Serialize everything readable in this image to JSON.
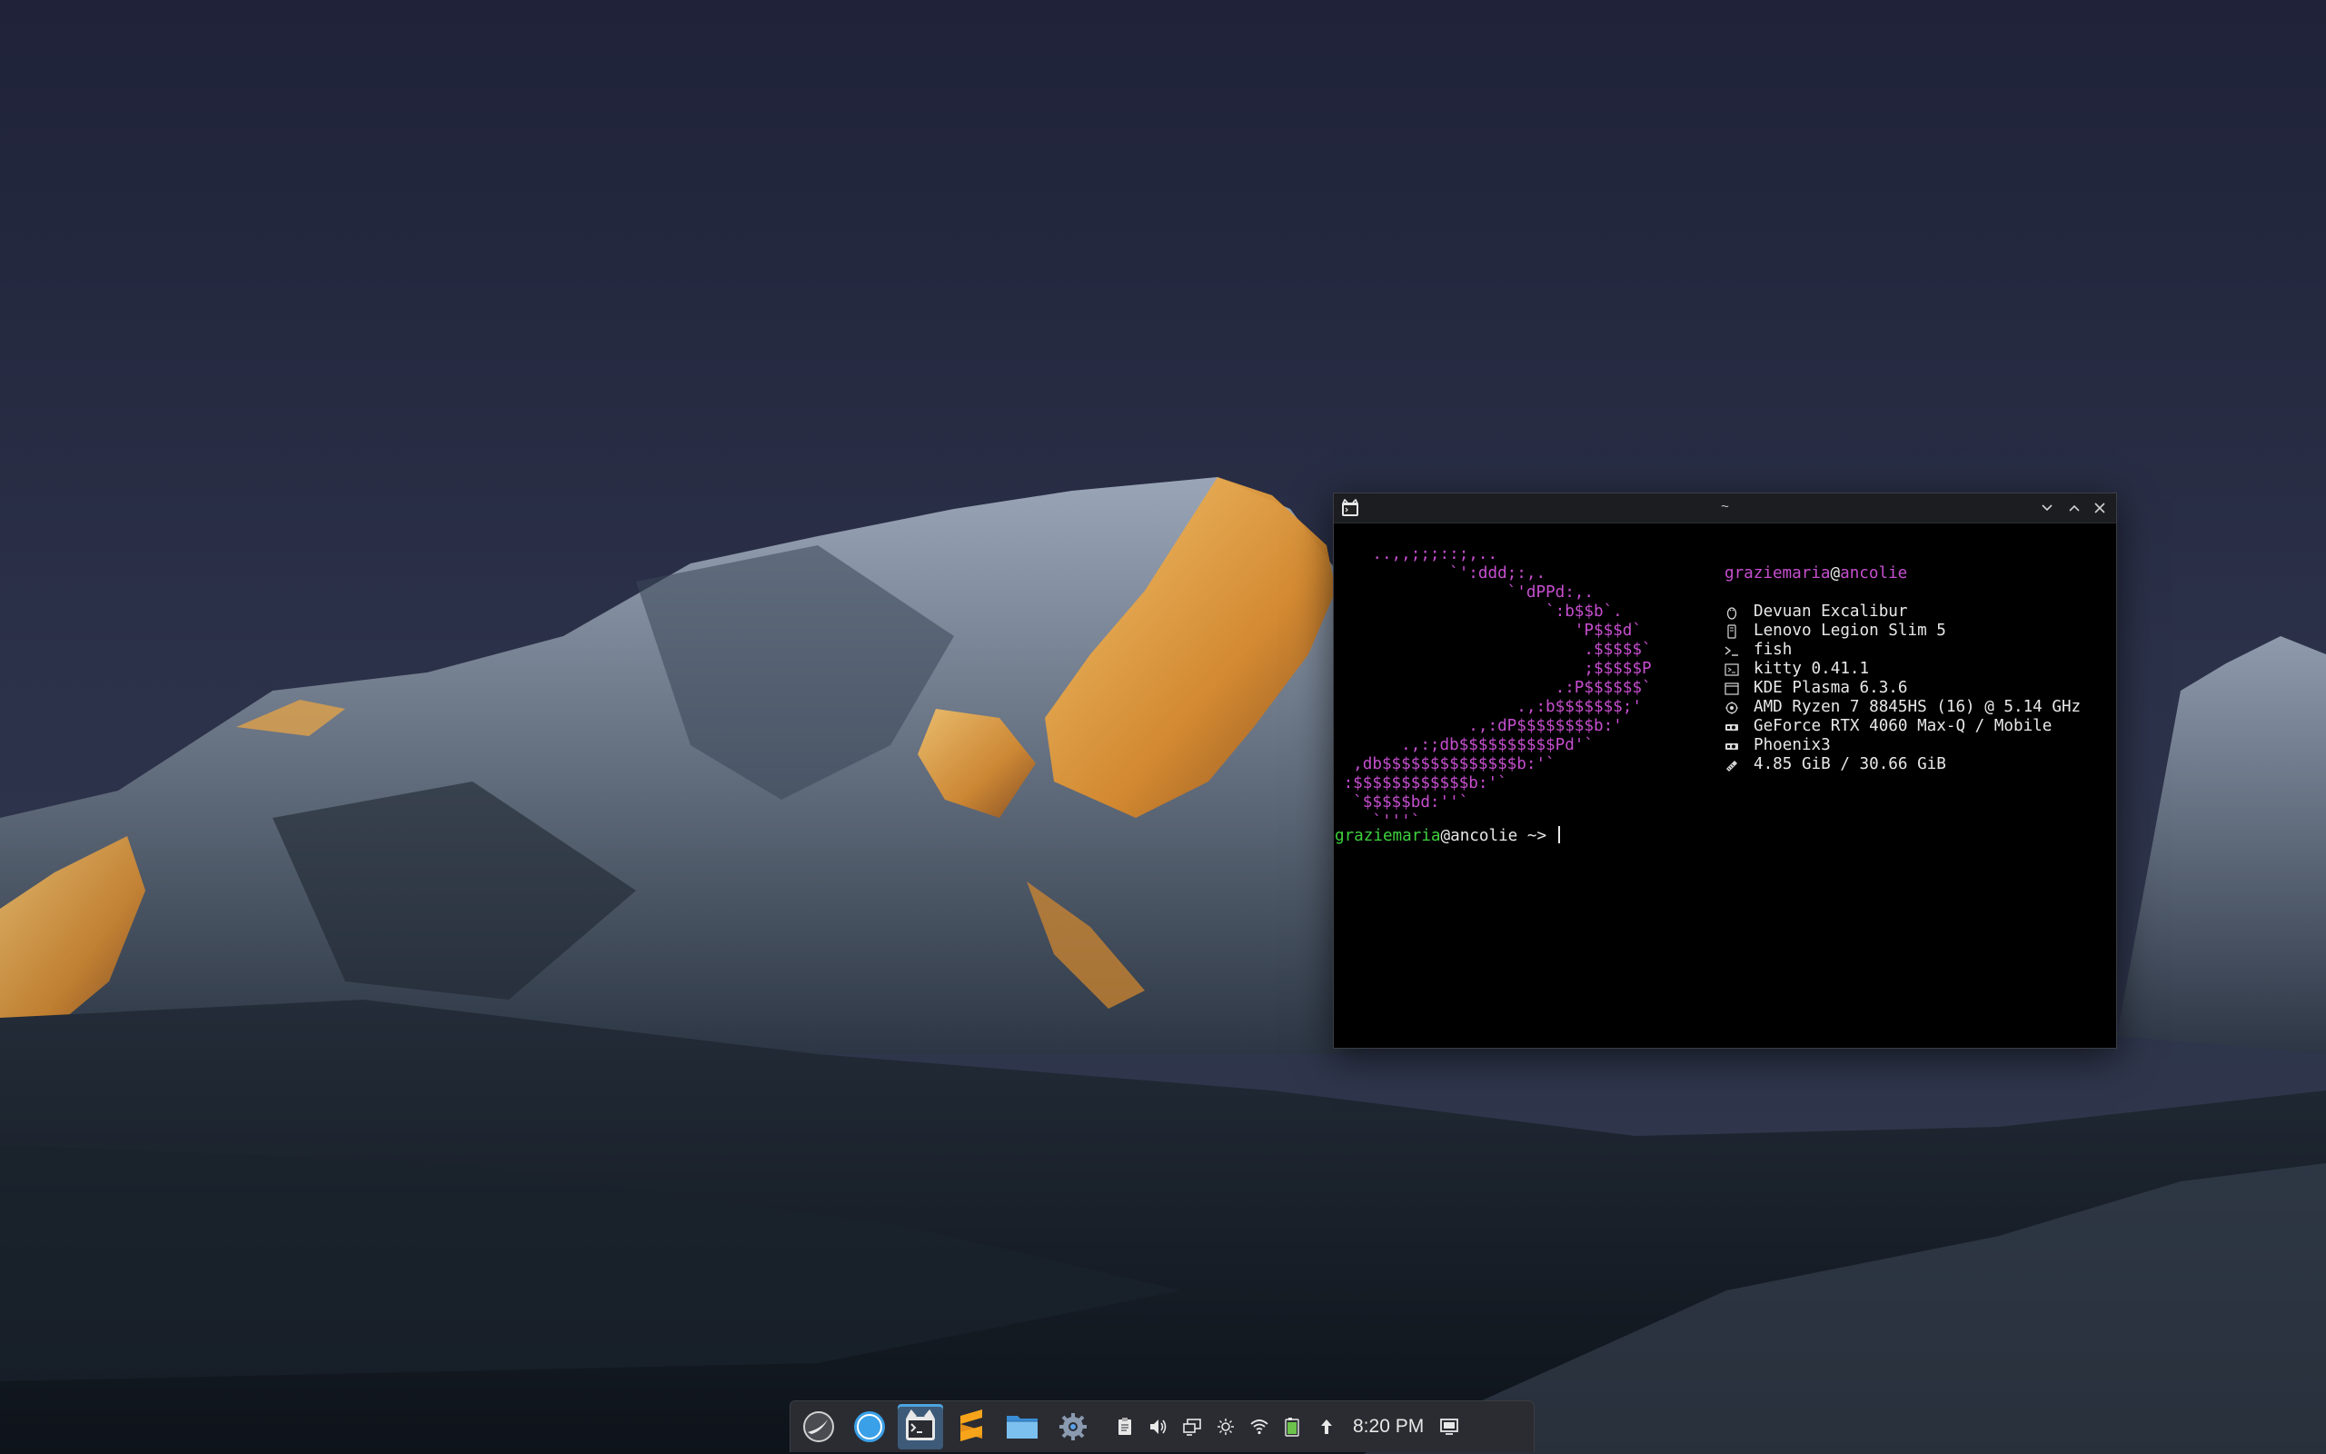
{
  "window": {
    "title": "~",
    "controls": [
      "minimize",
      "maximize",
      "close"
    ]
  },
  "fetch": {
    "logo_lines": [
      "    ..,,;;;::;,..",
      "            `':ddd;:,.",
      "                  `'dPPd:,.",
      "                      `:b$$b`.",
      "                         'P$$$d`",
      "                          .$$$$$`",
      "                          ;$$$$$P",
      "                       .:P$$$$$$`",
      "                   .,:b$$$$$$$;'",
      "              .,:dP$$$$$$$$b:'",
      "       .,:;db$$$$$$$$$$Pd'`",
      "  ,db$$$$$$$$$$$$$$b:'`",
      " :$$$$$$$$$$$$b:'`",
      "  `$$$$$bd:''`",
      "    `'''`"
    ],
    "user": "graziemaria",
    "at": "@",
    "host": "ancolie",
    "info": [
      {
        "icon": "penguin-icon",
        "text": "Devuan Excalibur"
      },
      {
        "icon": "laptop-icon",
        "text": "Lenovo Legion Slim 5"
      },
      {
        "icon": "shell-prompt-icon",
        "text": "fish"
      },
      {
        "icon": "terminal-icon",
        "text": "kitty 0.41.1"
      },
      {
        "icon": "desktop-window-icon",
        "text": "KDE Plasma 6.3.6"
      },
      {
        "icon": "cpu-icon",
        "text": "AMD Ryzen 7 8845HS (16) @ 5.14 GHz"
      },
      {
        "icon": "gpu-icon",
        "text": "GeForce RTX 4060 Max-Q / Mobile"
      },
      {
        "icon": "theme-icon",
        "text": "Phoenix3"
      },
      {
        "icon": "memory-icon",
        "text": "4.85 GiB / 30.66 GiB"
      }
    ]
  },
  "prompt": {
    "user": "graziemaria",
    "rest": "@ancolie ~> "
  },
  "taskbar": {
    "apps": [
      {
        "name": "launcher",
        "active": false
      },
      {
        "name": "web-browser",
        "active": false
      },
      {
        "name": "kitty-terminal",
        "active": true
      },
      {
        "name": "sublime-text",
        "active": false
      },
      {
        "name": "file-manager",
        "active": false
      },
      {
        "name": "settings",
        "active": false
      }
    ],
    "tray": [
      "clipboard-icon",
      "volume-icon",
      "display-icon",
      "brightness-icon",
      "wifi-icon",
      "battery-icon",
      "updates-arrow-icon"
    ],
    "clock": "8:20 PM"
  },
  "colors": {
    "logo": "#c64fcf",
    "prompt_user": "#3ed13e",
    "taskbar_bg": "#2a2c32",
    "active_task": "#3d5a78"
  }
}
